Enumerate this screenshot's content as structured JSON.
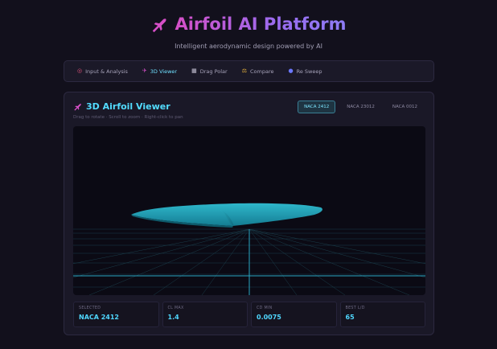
{
  "header": {
    "title": "Airfoil AI Platform",
    "subtitle": "Intelligent aerodynamic design powered by AI",
    "icon": "airplane-icon"
  },
  "nav": {
    "tabs": [
      {
        "label": "Input & Analysis",
        "icon": "target-icon"
      },
      {
        "label": "3D Viewer",
        "icon": "airplane-icon",
        "active": true
      },
      {
        "label": "Drag Polar",
        "icon": "chart-icon"
      },
      {
        "label": "Compare",
        "icon": "scales-icon"
      },
      {
        "label": "Re Sweep",
        "icon": "globe-icon"
      }
    ]
  },
  "viewer": {
    "title": "3D Airfoil Viewer",
    "hint": "Drag to rotate · Scroll to zoom · Right-click to pan",
    "variants": [
      {
        "label": "NACA 2412",
        "active": true
      },
      {
        "label": "NACA 23012"
      },
      {
        "label": "NACA 0012"
      }
    ]
  },
  "stats": [
    {
      "label": "SELECTED",
      "value": "NACA 2412"
    },
    {
      "label": "CL MAX",
      "value": "1.4"
    },
    {
      "label": "CD MIN",
      "value": "0.0075"
    },
    {
      "label": "BEST L/D",
      "value": "65"
    }
  ],
  "colors": {
    "accent": "#4fd7ff",
    "brand_gradient_start": "#d64fc7",
    "brand_gradient_end": "#8d7cf5",
    "wing": "#1ea2b8"
  }
}
